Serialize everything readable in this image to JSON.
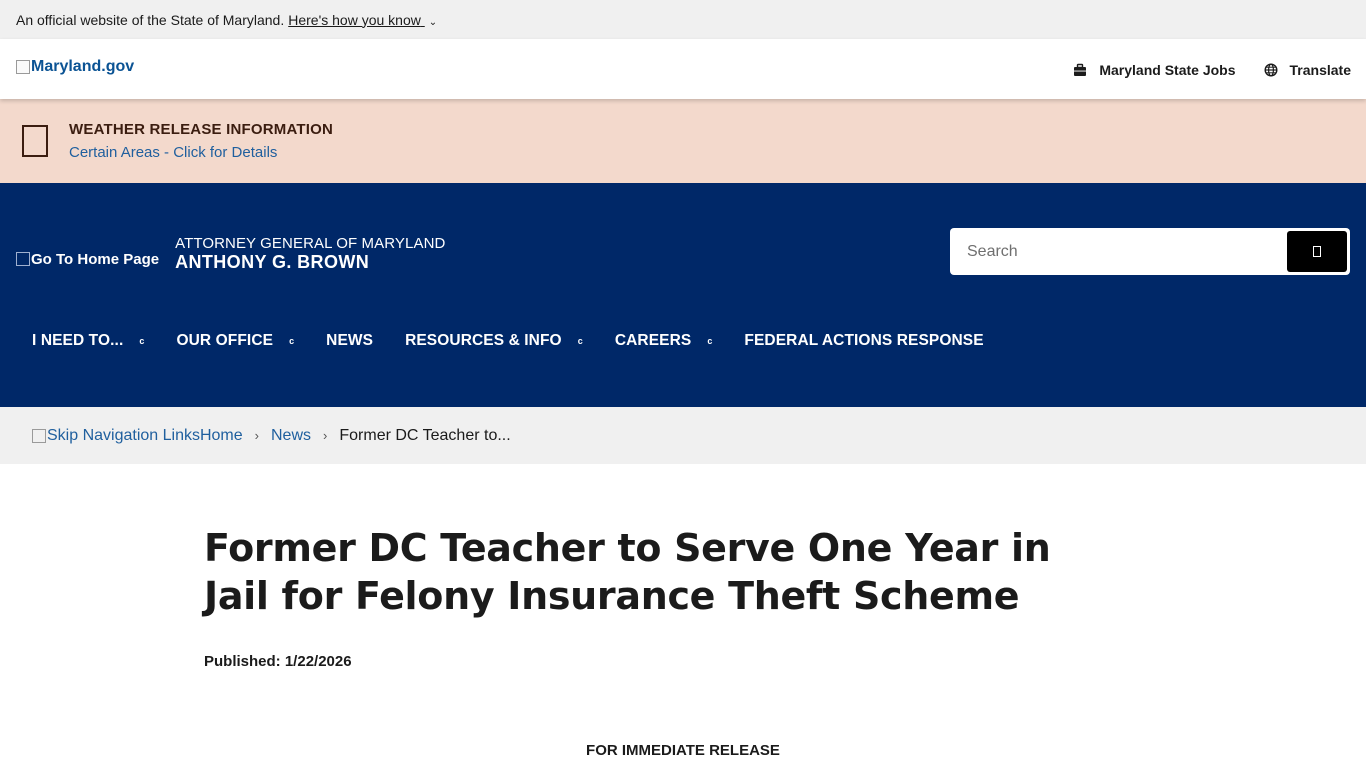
{
  "gov_banner": {
    "text": "An official website of the State of Maryland.",
    "link": "Here's how you know",
    "chevron": "⌄"
  },
  "md_header": {
    "logo_alt": "Maryland.gov",
    "links": [
      {
        "label": "Maryland State Jobs",
        "icon": "briefcase-icon"
      },
      {
        "label": "Translate",
        "icon": "globe-icon"
      }
    ]
  },
  "alert": {
    "title": "WEATHER RELEASE INFORMATION",
    "link": "Certain Areas - Click for Details"
  },
  "agency": {
    "home_alt": "Go To Home Page",
    "top_line": "ATTORNEY GENERAL OF MARYLAND",
    "name": "ANTHONY G. BROWN"
  },
  "search": {
    "placeholder": "Search"
  },
  "nav": [
    {
      "label": "I NEED TO...",
      "caret": "c"
    },
    {
      "label": "OUR OFFICE",
      "caret": "c"
    },
    {
      "label": "NEWS",
      "caret": ""
    },
    {
      "label": "RESOURCES & INFO",
      "caret": "c"
    },
    {
      "label": "CAREERS",
      "caret": "c"
    },
    {
      "label": "FEDERAL ACTIONS RESPONSE",
      "caret": ""
    }
  ],
  "breadcrumb": {
    "skip_alt": "Skip Navigation Links",
    "home": "Home",
    "news": "News",
    "current": "Former DC Teacher to..."
  },
  "article": {
    "title": "Former DC Teacher to Serve One Year in Jail for Felony Insurance Theft Scheme",
    "published": "Published: 1/22/2026",
    "release_label": "FOR IMMEDIATE RELEASE"
  }
}
